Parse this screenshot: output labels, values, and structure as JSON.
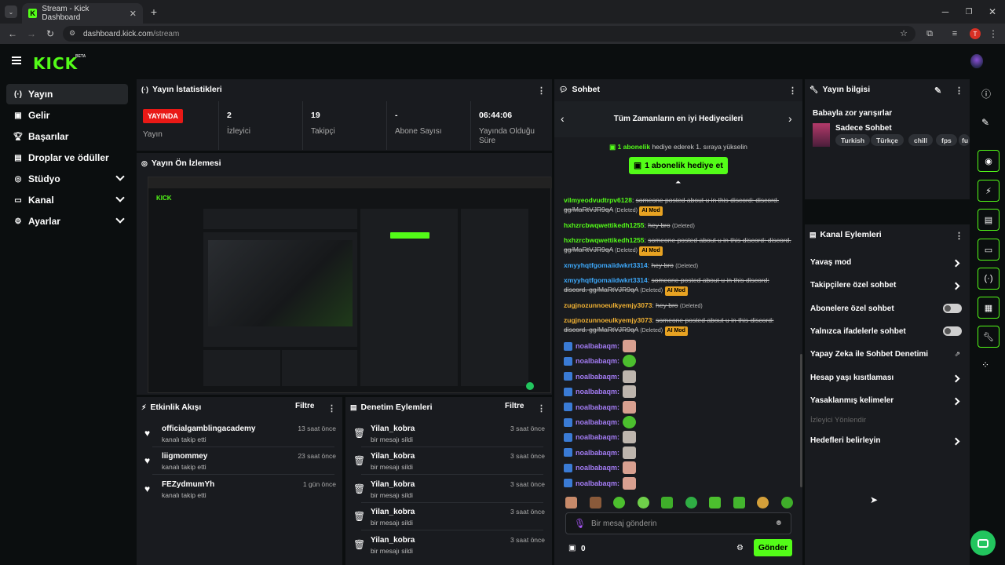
{
  "browser": {
    "tab_title": "Stream - Kick Dashboard",
    "url_host": "dashboard.kick.com",
    "url_path": "/stream",
    "profile_initial": "T"
  },
  "logo": {
    "text": "KICK",
    "badge": "BETA"
  },
  "sidebar": {
    "items": [
      {
        "label": "Yayın",
        "icon": "broadcast-icon",
        "active": true
      },
      {
        "label": "Gelir",
        "icon": "wallet-icon"
      },
      {
        "label": "Başarılar",
        "icon": "trophy-icon"
      },
      {
        "label": "Droplar ve ödüller",
        "icon": "gift-icon"
      },
      {
        "label": "Stüdyo",
        "icon": "studio-icon",
        "expandable": true
      },
      {
        "label": "Kanal",
        "icon": "channel-icon",
        "expandable": true
      },
      {
        "label": "Ayarlar",
        "icon": "gear-icon",
        "expandable": true
      }
    ]
  },
  "stats": {
    "title": "Yayın İstatistikleri",
    "live_badge": "YAYINDA",
    "status_label": "Yayın",
    "viewers_value": "2",
    "viewers_label": "İzleyici",
    "followers_value": "19",
    "followers_label": "Takipçi",
    "subs_value": "-",
    "subs_label": "Abone Sayısı",
    "uptime_value": "06:44:06",
    "uptime_label": "Yayında Olduğu Süre"
  },
  "preview": {
    "title": "Yayın Ön İzlemesi"
  },
  "activity": {
    "title": "Etkinlik Akışı",
    "filter": "Filtre",
    "items": [
      {
        "user": "officialgamblingacademy",
        "action": "kanalı takip etti",
        "time": "13 saat önce"
      },
      {
        "user": "liigmommey",
        "action": "kanalı takip etti",
        "time": "23 saat önce"
      },
      {
        "user": "FEZydmumYh",
        "action": "kanalı takip etti",
        "time": "1 gün önce"
      }
    ]
  },
  "moderation": {
    "title": "Denetim Eylemleri",
    "filter": "Filtre",
    "items": [
      {
        "user": "Yilan_kobra",
        "action": "bir mesajı sildi",
        "time": "3 saat önce"
      },
      {
        "user": "Yilan_kobra",
        "action": "bir mesajı sildi",
        "time": "3 saat önce"
      },
      {
        "user": "Yilan_kobra",
        "action": "bir mesajı sildi",
        "time": "3 saat önce"
      },
      {
        "user": "Yilan_kobra",
        "action": "bir mesajı sildi",
        "time": "3 saat önce"
      },
      {
        "user": "Yilan_kobra",
        "action": "bir mesajı sildi",
        "time": "3 saat önce"
      }
    ]
  },
  "chat": {
    "title": "Sohbet",
    "carousel_title": "Tüm Zamanların en iyi Hediyecileri",
    "gift_prompt_highlight": "1 abonelik",
    "gift_prompt_rest": "hediye ederek 1. sıraya yükselin",
    "gift_button": "1 abonelik hediye et",
    "messages": [
      {
        "user": "vilmyeodvudtrpv6128",
        "color": "#53fc18",
        "text": "someone posted about u in this discord: discord. gg/MaRtVJR9qA",
        "deleted": "(Deleted)",
        "aimod": "AI Mod"
      },
      {
        "user": "hxhzrcbwqwettikedh1255",
        "color": "#53fc18",
        "text": "hey bro",
        "deleted": "(Deleted)",
        "aimod": ""
      },
      {
        "user": "hxhzrcbwqwettikedh1255",
        "color": "#53fc18",
        "text": "someone posted about u in this discord: discord. gg/MaRtVJR9qA",
        "deleted": "(Deleted)",
        "aimod": "AI Mod"
      },
      {
        "user": "xmyyhqtfgomaiidwkrt3314",
        "color": "#3da9fc",
        "text": "hey bro",
        "deleted": "(Deleted)",
        "aimod": ""
      },
      {
        "user": "xmyyhqtfgomaiidwkrt3314",
        "color": "#3da9fc",
        "text": "someone posted about u in this discord: discord. gg/MaRtVJR9qA",
        "deleted": "(Deleted)",
        "aimod": "AI Mod"
      },
      {
        "user": "zugjnozunnoeulkyemjy3073",
        "color": "#f2b233",
        "text": "hey bro",
        "deleted": "(Deleted)",
        "aimod": ""
      },
      {
        "user": "zugjnozunnoeulkyemjy3073",
        "color": "#f2b233",
        "text": "someone posted about u in this discord: discord. gg/MaRtVJR9qA",
        "deleted": "(Deleted)",
        "aimod": "AI Mod"
      }
    ],
    "emote_user": "noalbabaqm:",
    "emote_kinds": [
      "face",
      "green",
      "cat",
      "cat",
      "face",
      "green",
      "cat",
      "cat",
      "face",
      "face"
    ],
    "input_placeholder": "Bir mesaj gönderin",
    "gift_count": "0",
    "send_button": "Gönder"
  },
  "stream_info": {
    "title": "Yayın bilgisi",
    "stream_title": "Babayla zor yarışırlar",
    "category": "Sadece Sohbet",
    "tags": [
      "Turkish",
      "Türkçe",
      "chill",
      "fps",
      "fu"
    ]
  },
  "channel_actions": {
    "title": "Kanal Eylemleri",
    "items": [
      {
        "label": "Yavaş mod",
        "control": "chevron"
      },
      {
        "label": "Takipçilere özel sohbet",
        "control": "chevron"
      },
      {
        "label": "Abonelere özel sohbet",
        "control": "toggle"
      },
      {
        "label": "Yalnızca ifadelerle sohbet",
        "control": "toggle"
      },
      {
        "label": "Yapay Zeka ile Sohbet Denetimi",
        "control": "external"
      },
      {
        "label": "Hesap yaşı kısıtlaması",
        "control": "chevron"
      },
      {
        "label": "Yasaklanmış kelimeler",
        "control": "chevron"
      },
      {
        "label": "İzleyici Yönlendir",
        "control": "disabled"
      },
      {
        "label": "Hedefleri belirleyin",
        "control": "chevron"
      }
    ]
  },
  "colors": {
    "accent": "#53fc18",
    "live": "#e91916",
    "panel": "#191b1f",
    "aimod": "#e8a322"
  }
}
